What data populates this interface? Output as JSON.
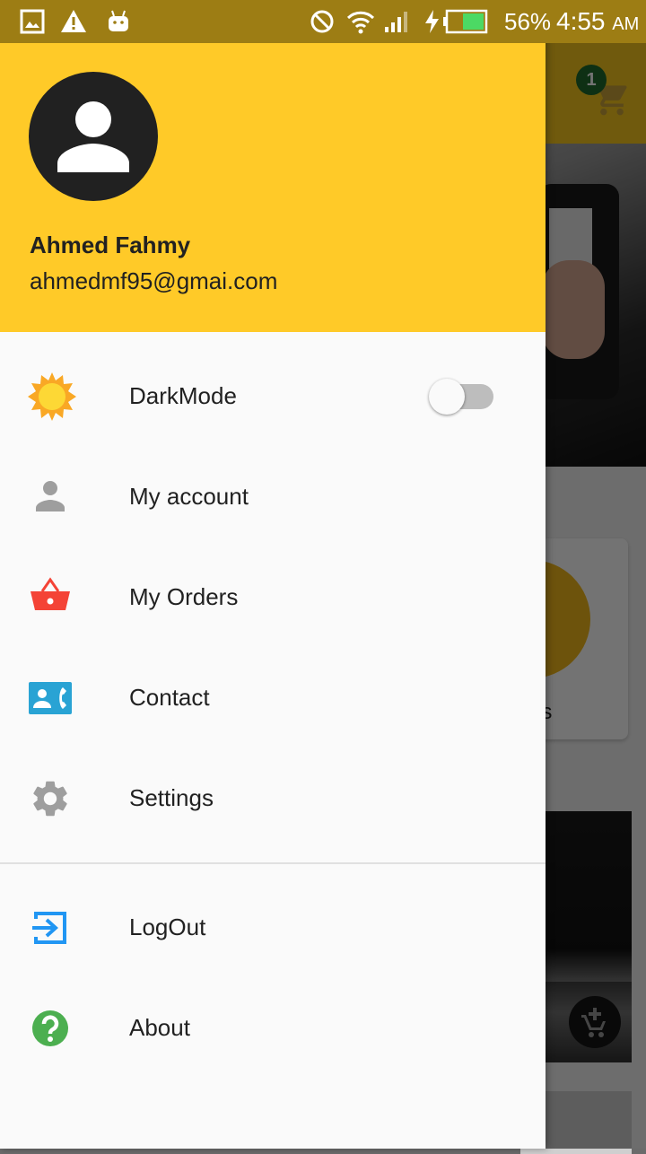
{
  "status_bar": {
    "battery_percent": "56%",
    "time": "4:55",
    "ampm": "AM",
    "icons": [
      "gallery-icon",
      "warning-icon",
      "android-icon",
      "do-not-disturb-icon",
      "wifi-icon",
      "signal-icon",
      "charging-icon",
      "battery-icon"
    ],
    "battery_level": 0.56
  },
  "background": {
    "cart_badge": "1",
    "card_text": "es"
  },
  "drawer": {
    "user": {
      "name": "Ahmed Fahmy",
      "email": "ahmedmf95@gmai.com"
    },
    "items": [
      {
        "label": "DarkMode",
        "icon": "sun-icon",
        "toggle": false
      },
      {
        "label": "My account",
        "icon": "person-icon"
      },
      {
        "label": "My Orders",
        "icon": "basket-icon"
      },
      {
        "label": "Contact",
        "icon": "contact-icon"
      },
      {
        "label": "Settings",
        "icon": "gear-icon"
      }
    ],
    "footer_items": [
      {
        "label": "LogOut",
        "icon": "logout-icon"
      },
      {
        "label": "About",
        "icon": "help-icon"
      }
    ]
  },
  "colors": {
    "header": "#ffca28",
    "status_bar": "#9d7d14",
    "basket": "#f44336",
    "contact": "#29a3d4",
    "logout": "#2196f3",
    "about": "#4caf50"
  }
}
